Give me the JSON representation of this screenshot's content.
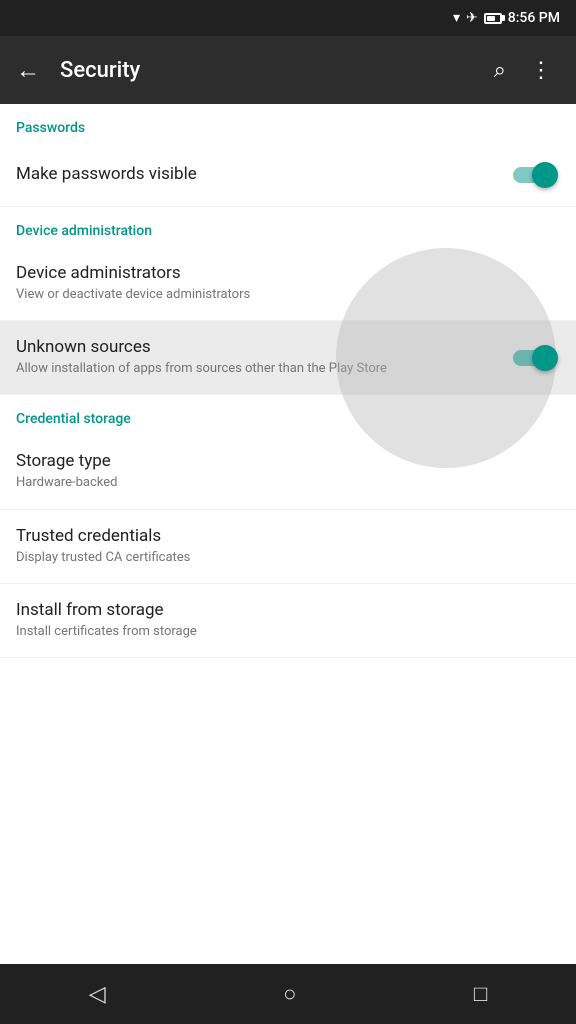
{
  "statusBar": {
    "time": "8:56 PM"
  },
  "appBar": {
    "backLabel": "←",
    "title": "Security",
    "searchLabel": "⌕",
    "moreLabel": "⋮"
  },
  "sections": [
    {
      "id": "passwords",
      "header": "Passwords",
      "items": [
        {
          "id": "make-passwords-visible",
          "title": "Make passwords visible",
          "subtitle": "",
          "hasToggle": true,
          "toggleOn": true,
          "highlighted": false
        }
      ]
    },
    {
      "id": "device-administration",
      "header": "Device administration",
      "items": [
        {
          "id": "device-administrators",
          "title": "Device administrators",
          "subtitle": "View or deactivate device administrators",
          "hasToggle": false,
          "highlighted": false
        },
        {
          "id": "unknown-sources",
          "title": "Unknown sources",
          "subtitle": "Allow installation of apps from sources other than the Play Store",
          "hasToggle": true,
          "toggleOn": true,
          "highlighted": true
        }
      ]
    },
    {
      "id": "credential-storage",
      "header": "Credential storage",
      "items": [
        {
          "id": "storage-type",
          "title": "Storage type",
          "subtitle": "Hardware-backed",
          "hasToggle": false,
          "highlighted": false
        },
        {
          "id": "trusted-credentials",
          "title": "Trusted credentials",
          "subtitle": "Display trusted CA certificates",
          "hasToggle": false,
          "highlighted": false
        },
        {
          "id": "install-from-storage",
          "title": "Install from storage",
          "subtitle": "Install certificates from storage",
          "hasToggle": false,
          "highlighted": false
        }
      ]
    }
  ],
  "navBar": {
    "backLabel": "◁",
    "homeLabel": "○",
    "recentLabel": "□"
  }
}
